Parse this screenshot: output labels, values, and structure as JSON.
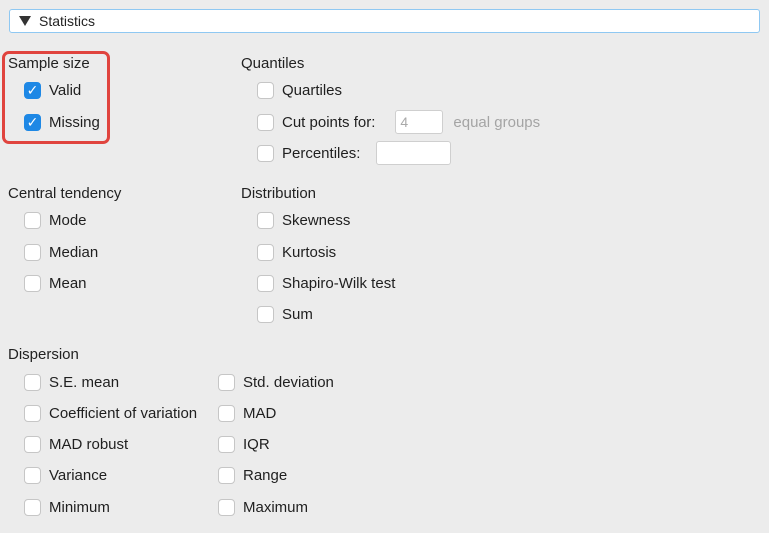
{
  "header": {
    "title": "Statistics"
  },
  "sample_size": {
    "title": "Sample size",
    "items": [
      {
        "label": "Valid",
        "checked": true
      },
      {
        "label": "Missing",
        "checked": true
      }
    ]
  },
  "quantiles": {
    "title": "Quantiles",
    "quartiles": {
      "label": "Quartiles",
      "checked": false
    },
    "cut_points": {
      "label": "Cut points for:",
      "checked": false,
      "value": "4",
      "suffix": "equal groups"
    },
    "percentiles": {
      "label": "Percentiles:",
      "checked": false,
      "value": ""
    }
  },
  "central_tendency": {
    "title": "Central tendency",
    "items": [
      {
        "label": "Mode",
        "checked": false
      },
      {
        "label": "Median",
        "checked": false
      },
      {
        "label": "Mean",
        "checked": false
      }
    ]
  },
  "distribution": {
    "title": "Distribution",
    "items": [
      {
        "label": "Skewness",
        "checked": false
      },
      {
        "label": "Kurtosis",
        "checked": false
      },
      {
        "label": "Shapiro-Wilk test",
        "checked": false
      },
      {
        "label": "Sum",
        "checked": false
      }
    ]
  },
  "dispersion": {
    "title": "Dispersion",
    "left": [
      {
        "label": "S.E. mean",
        "checked": false
      },
      {
        "label": "Coefficient of variation",
        "checked": false
      },
      {
        "label": "MAD robust",
        "checked": false
      },
      {
        "label": "Variance",
        "checked": false
      },
      {
        "label": "Minimum",
        "checked": false
      }
    ],
    "right": [
      {
        "label": "Std. deviation",
        "checked": false
      },
      {
        "label": "MAD",
        "checked": false
      },
      {
        "label": "IQR",
        "checked": false
      },
      {
        "label": "Range",
        "checked": false
      },
      {
        "label": "Maximum",
        "checked": false
      }
    ]
  },
  "colors": {
    "accent": "#1e88e5",
    "highlight": "#e0443e",
    "header_border": "#8fc8f2",
    "background": "#ececec"
  },
  "icons": {
    "collapse": "triangle-down-icon",
    "check": "checkmark-icon"
  }
}
